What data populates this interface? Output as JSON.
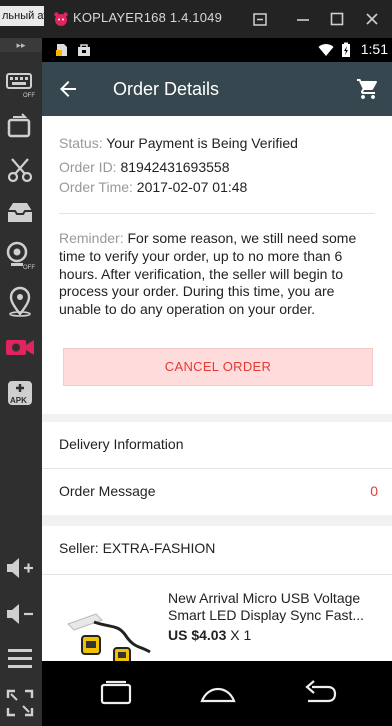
{
  "emulator": {
    "prev_tab_label": "льный ат",
    "title": "KOPLAYER168 1.4.1049",
    "buttons": [
      "restore-icon",
      "minimize-icon",
      "maximize-icon",
      "close-icon"
    ],
    "sidebar_buttons": [
      "keyboard-icon",
      "rotate-icon",
      "scissors-icon",
      "inbox-icon",
      "camera-off-icon",
      "location-icon",
      "video-record-icon",
      "apk-install-icon",
      "volume-up-icon",
      "volume-down-icon",
      "menu-icon",
      "fullscreen-icon"
    ],
    "accent_color": "#e0245e"
  },
  "status_bar": {
    "time": "1:51"
  },
  "appbar": {
    "title": "Order Details"
  },
  "order": {
    "status_label": "Status:",
    "status_value": "Your Payment is Being Verified",
    "id_label": "Order ID:",
    "id_value": "81942431693558",
    "time_label": "Order Time:",
    "time_value": "2017-02-07 01:48",
    "reminder_label": "Reminder:",
    "reminder_text": "For some reason, we still need some time to verify your order, up to no more than 6 hours. After verification, the seller will begin to process your order. During this time, you are unable to do any operation on your order.",
    "cancel_label": "CANCEL ORDER"
  },
  "rows": {
    "delivery_label": "Delivery Information",
    "message_label": "Order Message",
    "message_count": "0"
  },
  "seller": {
    "label": "Seller: EXTRA-FASHION",
    "product_title": "New Arrival Micro USB Voltage Smart LED Display Sync Fast...",
    "product_price": "US $4.03",
    "product_qty": "X 1"
  }
}
